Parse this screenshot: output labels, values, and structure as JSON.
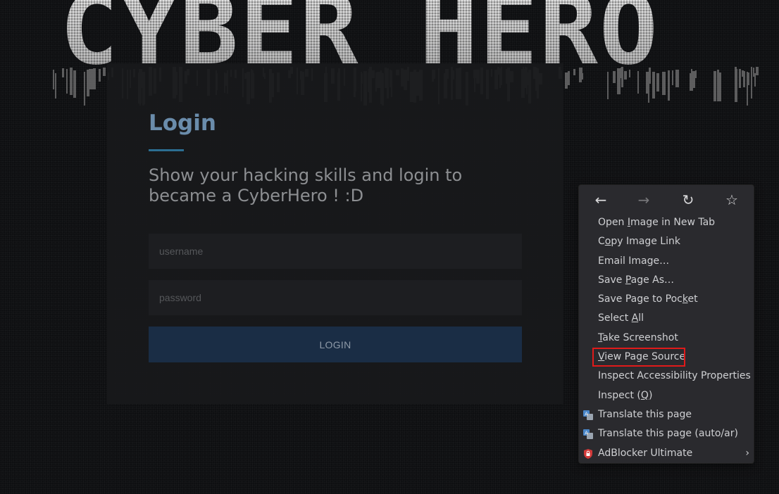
{
  "banner": {
    "text": "CYBER HERO"
  },
  "login": {
    "title": "Login",
    "subtitle": "Show your hacking skills and login to became a CyberHero ! :D",
    "username_placeholder": "username",
    "password_placeholder": "password",
    "button_label": "LOGIN"
  },
  "context_menu": {
    "nav": {
      "back": "←",
      "forward": "→",
      "reload": "↻",
      "bookmark": "☆"
    },
    "items": [
      {
        "pre": "Open ",
        "key": "I",
        "post": "mage in New Tab"
      },
      {
        "pre": "C",
        "key": "o",
        "post": "py Image Link"
      },
      {
        "pre": "Email Ima",
        "key": "g",
        "post": "e…"
      },
      {
        "pre": "Save ",
        "key": "P",
        "post": "age As…"
      },
      {
        "pre": "Save Page to Poc",
        "key": "k",
        "post": "et"
      },
      {
        "pre": "Select ",
        "key": "A",
        "post": "ll"
      },
      {
        "pre": "",
        "key": "T",
        "post": "ake Screenshot"
      },
      {
        "pre": "",
        "key": "V",
        "post": "iew Page Source"
      },
      {
        "pre": "Inspect Accessibility Properties",
        "key": "",
        "post": ""
      },
      {
        "pre": "Inspect (",
        "key": "Q",
        "post": ")"
      },
      {
        "pre": "Translate this page",
        "key": "",
        "post": ""
      },
      {
        "pre": "Translate this page (auto/ar)",
        "key": "",
        "post": ""
      },
      {
        "pre": "AdBlocker Ultimate",
        "key": "",
        "post": ""
      }
    ],
    "submenu_arrow": "›"
  },
  "colors": {
    "highlight": "#e01a1a",
    "accent": "#2c6e92",
    "title": "#6a8cab"
  }
}
